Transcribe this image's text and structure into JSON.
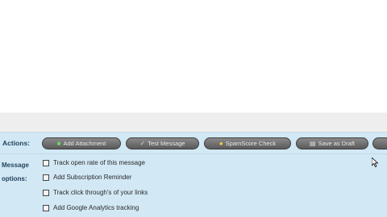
{
  "actions": {
    "label": "Actions:",
    "buttons": [
      {
        "label": "Add Attachment",
        "icon": "paperclip-icon"
      },
      {
        "label": "Test Message",
        "icon": "check-icon"
      },
      {
        "label": "SpamScore Check",
        "icon": "shield-icon"
      },
      {
        "label": "Save as Draft",
        "icon": "save-icon"
      }
    ]
  },
  "options": {
    "label_line1": "Message",
    "label_line2": "options:",
    "items": [
      {
        "label": "Track open rate of this message"
      },
      {
        "label": "Add Subscription Reminder"
      },
      {
        "label": "Track click through's of your links"
      },
      {
        "label": "Add Google Analytics tracking"
      }
    ]
  }
}
